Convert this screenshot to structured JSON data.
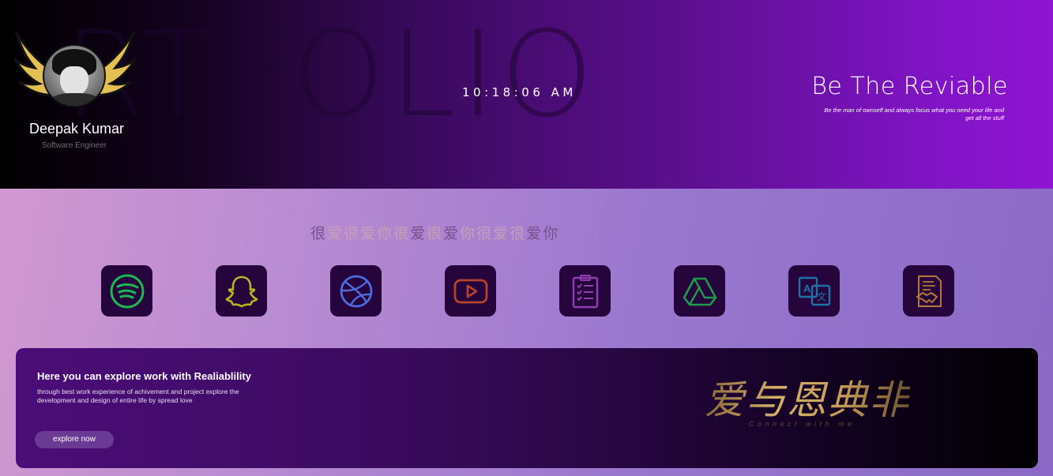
{
  "header": {
    "background_word": "RTFOLIO",
    "profile": {
      "name": "Deepak Kumar",
      "role": "Software Engineer"
    },
    "clock": "10:18:06 AM",
    "tagline": "Be The Reviable",
    "tagline_sub": "Be the man of ownself and always focus what you need your life and get all the stuff"
  },
  "decorative_line": [
    "很",
    "爱",
    "很",
    "爱",
    "你",
    "很",
    "爱",
    "很",
    "爱",
    "你",
    "很",
    "爱",
    "很",
    "爱",
    "你"
  ],
  "icons": [
    {
      "name": "spotify-icon",
      "color": "#1db954"
    },
    {
      "name": "snapchat-icon",
      "color": "#b6b61e"
    },
    {
      "name": "dribbble-icon",
      "color": "#4f6be0"
    },
    {
      "name": "youtube-icon",
      "color": "#b8432c"
    },
    {
      "name": "clipboard-icon",
      "color": "#8f3fb0"
    },
    {
      "name": "google-drive-icon",
      "color": "#1f9a4c"
    },
    {
      "name": "translate-icon",
      "color": "#1d73a8"
    },
    {
      "name": "contract-handshake-icon",
      "color": "#b37736"
    }
  ],
  "banner": {
    "title": "Here you can explore work with Realiablility",
    "description": "through best work experience of achivement and project explore the development and design of entire life by spread love",
    "button_label": "explore now",
    "chinese_text": "爱与恩典非",
    "connect_text": "Connect with me"
  },
  "colors": {
    "header_start": "#000000",
    "header_end": "#9014d2",
    "tile_bg": "#26053d",
    "banner_gold": "#d4b06a"
  }
}
